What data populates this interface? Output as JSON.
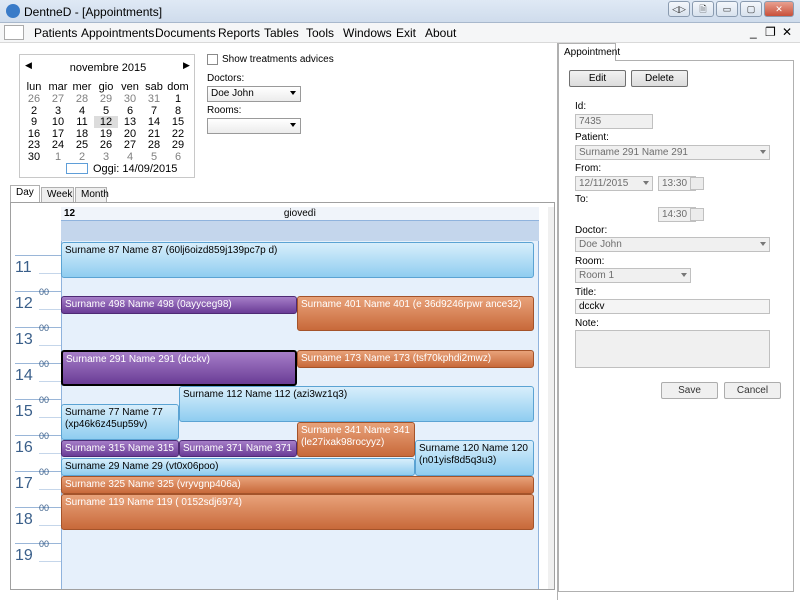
{
  "window": {
    "title": "DentneD - [Appointments]",
    "buttons": [
      "◁▷",
      "🗎",
      "▭",
      "▢",
      "✕"
    ]
  },
  "menu": {
    "items": [
      "Patients",
      "Appointments",
      "Documents",
      "Reports",
      "Tables",
      "Tools",
      "Windows",
      "Exit",
      "About"
    ],
    "mdi_controls": [
      "_",
      "❐",
      "✕"
    ]
  },
  "calendar": {
    "month_label": "novembre 2015",
    "prev": "◀",
    "next": "▶",
    "weekdays": [
      "lun",
      "mar",
      "mer",
      "gio",
      "ven",
      "sab",
      "dom"
    ],
    "weeks": [
      [
        "26",
        "27",
        "28",
        "29",
        "30",
        "31",
        "1"
      ],
      [
        "2",
        "3",
        "4",
        "5",
        "6",
        "7",
        "8"
      ],
      [
        "9",
        "10",
        "11",
        "12",
        "13",
        "14",
        "15"
      ],
      [
        "16",
        "17",
        "18",
        "19",
        "20",
        "21",
        "22"
      ],
      [
        "23",
        "24",
        "25",
        "26",
        "27",
        "28",
        "29"
      ],
      [
        "30",
        "1",
        "2",
        "3",
        "4",
        "5",
        "6"
      ]
    ],
    "today_label": "Oggi: 14/09/2015"
  },
  "filters": {
    "show_treatments_label": "Show treatments advices",
    "doctors_label": "Doctors:",
    "doctor_value": "Doe John",
    "rooms_label": "Rooms:",
    "room_value": ""
  },
  "scheduler": {
    "tabs": [
      "Day",
      "Week",
      "Month"
    ],
    "day_number": "12",
    "day_name": "giovedì",
    "hours": [
      "11",
      "12",
      "13",
      "14",
      "15",
      "16",
      "17",
      "18",
      "19"
    ],
    "minutes_label": "00",
    "appointments": [
      {
        "text": "Surname 87 Name 87 (60lj6oizd859j139pc7p d)",
        "color": "blue"
      },
      {
        "text": "Surname 498 Name 498 (0ayyceg98)",
        "color": "purple"
      },
      {
        "text": "Surname 401 Name 401 (e 36d9246rpwr ance32)",
        "color": "orange"
      },
      {
        "text": "Surname 291 Name 291 (dcckv)",
        "color": "purple"
      },
      {
        "text": "Surname 173 Name 173 (tsf70kphdi2mwz)",
        "color": "orange"
      },
      {
        "text": "Surname 112 Name 112 (azi3wz1q3)",
        "color": "blue"
      },
      {
        "text": "Surname 77 Name 77 (xp46k6z45up59v)",
        "color": "blue"
      },
      {
        "text": "Surname 341 Name 341 (le27ixak98rocyyz)",
        "color": "orange"
      },
      {
        "text": "Surname 315 Name 315",
        "color": "purple"
      },
      {
        "text": "Surname 371 Name 371",
        "color": "purple"
      },
      {
        "text": "Surname 120 Name 120 (n01yisf8d5q3u3)",
        "color": "blue"
      },
      {
        "text": "Surname 29 Name 29 (vt0x06poo)",
        "color": "blue"
      },
      {
        "text": "Surname 325 Name 325 (vryvgnp406a)",
        "color": "orange"
      },
      {
        "text": "Surname 119 Name 119 ( 0152sdj6974)",
        "color": "orange"
      }
    ]
  },
  "appointment_panel": {
    "tab_label": "Appointment",
    "edit_label": "Edit",
    "delete_label": "Delete",
    "id_label": "Id:",
    "id_value": "7435",
    "patient_label": "Patient:",
    "patient_value": "Surname 291 Name 291",
    "from_label": "From:",
    "from_date": "12/11/2015",
    "from_time": "13:30",
    "to_label": "To:",
    "to_time": "14:30",
    "doctor_label": "Doctor:",
    "doctor_value": "Doe John",
    "room_label": "Room:",
    "room_value": "Room 1",
    "title_label": "Title:",
    "title_value": "dcckv",
    "note_label": "Note:",
    "note_value": "",
    "save_label": "Save",
    "cancel_label": "Cancel"
  }
}
